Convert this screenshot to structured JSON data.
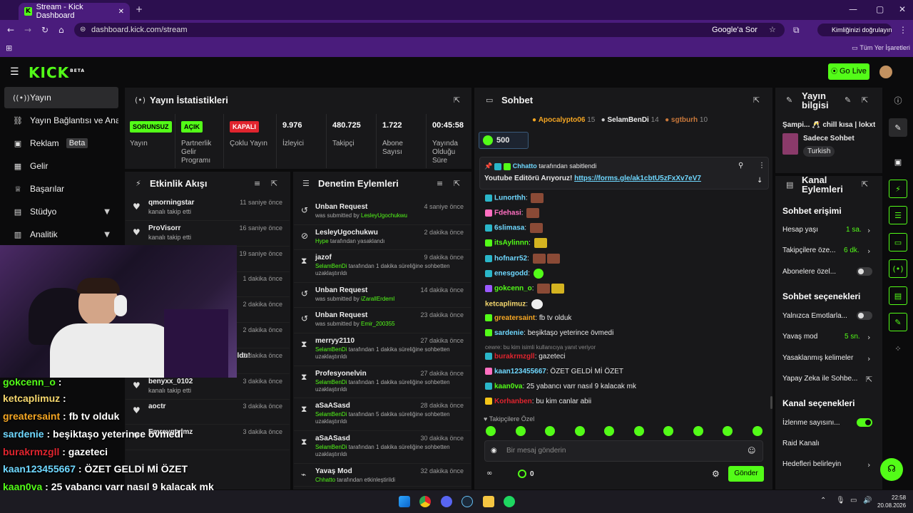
{
  "browser": {
    "tab_title": "Stream - Kick Dashboard",
    "url": "dashboard.kick.com/stream",
    "search_label": "Google'a Sor",
    "profile_label": "Kimliğinizi doğrulayın",
    "bookmarks_label": "Tüm Yer İşaretleri"
  },
  "header": {
    "logo": "KICK",
    "logo_badge": "BETA",
    "go_live": "Go Live"
  },
  "sidebar": {
    "items": [
      {
        "label": "Yayın",
        "icon": "broadcast-icon"
      },
      {
        "label": "Yayın Bağlantısı ve Anahtarı",
        "icon": "link-icon"
      },
      {
        "label": "Reklam",
        "icon": "ad-icon",
        "badge": "Beta"
      },
      {
        "label": "Gelir",
        "icon": "revenue-icon"
      },
      {
        "label": "Başarılar",
        "icon": "trophy-icon"
      },
      {
        "label": "Stüdyo",
        "icon": "studio-icon"
      },
      {
        "label": "Analitik",
        "icon": "analytics-icon"
      }
    ]
  },
  "stats": {
    "title": "Yayın İstatistikleri",
    "cells": [
      {
        "badge": "SORUNSUZ",
        "label": "Yayın",
        "color": "#53fc18"
      },
      {
        "badge": "AÇIK",
        "label": "Partnerlik Gelir Programı",
        "color": "#53fc18"
      },
      {
        "badge": "KAPALI",
        "label": "Çoklu Yayın",
        "color": "#e0242e"
      },
      {
        "value": "9.976",
        "label": "İzleyici"
      },
      {
        "value": "480.725",
        "label": "Takipçi"
      },
      {
        "value": "1.722",
        "label": "Abone Sayısı"
      },
      {
        "value": "00:45:58",
        "label": "Yayında Olduğu Süre"
      }
    ]
  },
  "activity": {
    "title": "Etkinlik Akışı",
    "rows": [
      {
        "name": "qmorningstar",
        "sub": "kanalı takip etti",
        "time": "11 saniye önce"
      },
      {
        "name": "ProVisorr",
        "sub": "kanalı takip etti",
        "time": "16 saniye önce"
      },
      {
        "name": "",
        "sub": "",
        "time": "19 saniye önce"
      },
      {
        "name": "u!",
        "sub": "",
        "time": "1 dakika önce"
      },
      {
        "name": "",
        "sub": "oplam abonelik",
        "time": "2 dakika önce"
      },
      {
        "name": "",
        "sub": "",
        "time": "2 dakika önce"
      },
      {
        "name": "scathaaa yeniden abone oldu!",
        "sub": "12 aylık abone oldular",
        "time": "2 dakika önce"
      },
      {
        "name": "benyxx_0102",
        "sub": "kanalı takip etti",
        "time": "3 dakika önce"
      },
      {
        "name": "aoctr",
        "sub": "",
        "time": "3 dakika önce"
      },
      {
        "name": "Emreygtylmz",
        "sub": "",
        "time": "3 dakika önce"
      }
    ]
  },
  "moderation": {
    "title": "Denetim Eylemleri",
    "rows": [
      {
        "icon": "undo-icon",
        "title": "Unban Request",
        "sub": "was submitted by ",
        "who": "LesleyUgochukwu",
        "sub2": "",
        "time": "4 saniye önce"
      },
      {
        "icon": "ban-icon",
        "title": "LesleyUgochukwu",
        "sub": "",
        "who": "Hype",
        "sub2": " tarafından yasaklandı",
        "time": "2 dakika önce"
      },
      {
        "icon": "hourglass-icon",
        "title": "jazof",
        "sub": "",
        "who": "SelamBenDi",
        "sub2": " tarafından 1 dakika süreliğine sohbetten uzaklaştırıldı",
        "time": "9 dakika önce"
      },
      {
        "icon": "undo-icon",
        "title": "Unban Request",
        "sub": "was submitted by ",
        "who": "iZarallErdeml",
        "sub2": "",
        "time": "14 dakika önce"
      },
      {
        "icon": "undo-icon",
        "title": "Unban Request",
        "sub": "was submitted by ",
        "who": "Emir_200355",
        "sub2": "",
        "time": "23 dakika önce"
      },
      {
        "icon": "hourglass-icon",
        "title": "merryy2110",
        "sub": "",
        "who": "SelamBenDi",
        "sub2": " tarafından 1 dakika süreliğine sohbetten uzaklaştırıldı",
        "time": "27 dakika önce"
      },
      {
        "icon": "hourglass-icon",
        "title": "Profesyonelvin",
        "sub": "",
        "who": "SelamBenDi",
        "sub2": " tarafından 1 dakika süreliğine sohbetten uzaklaştırıldı",
        "time": "27 dakika önce"
      },
      {
        "icon": "hourglass-icon",
        "title": "aSaASasd",
        "sub": "",
        "who": "SelamBenDi",
        "sub2": " tarafından 5 dakika süreliğine sohbetten uzaklaştırıldı",
        "time": "28 dakika önce"
      },
      {
        "icon": "hourglass-icon",
        "title": "aSaASasd",
        "sub": "",
        "who": "SelamBenDi",
        "sub2": " tarafından 1 dakika süreliğine sohbetten uzaklaştırıldı",
        "time": "30 dakika önce"
      },
      {
        "icon": "slow-icon",
        "title": "Yavaş Mod",
        "sub": "",
        "who": "Chhatto",
        "sub2": " tarafından etkinleştirildi",
        "time": "32 dakika önce"
      }
    ]
  },
  "chat": {
    "title": "Sohbet",
    "top": [
      {
        "name": "Apocalypto06",
        "count": "15"
      },
      {
        "name": "SelamBenDi",
        "count": "14"
      },
      {
        "name": "sgtburh",
        "count": "10"
      }
    ],
    "gift_count": "500",
    "pinned_by": "Chhatto",
    "pinned_suffix": "tarafından sabitlendi",
    "pinned_text": "Youtube Editörü Arıyoruz! ",
    "pinned_link": "https://forms.gle/ak1cbtU5zFxXv7eV7",
    "messages": [
      {
        "name": "Lunorthh",
        "color": "#6fd8ff",
        "text": ""
      },
      {
        "name": "Fdehasi",
        "color": "#ff6fc1",
        "text": ""
      },
      {
        "name": "6slimasa",
        "color": "#6fd8ff",
        "text": ""
      },
      {
        "name": "itsAylinnn",
        "color": "#53fc18",
        "text": ""
      },
      {
        "name": "hofnarr52",
        "color": "#6fd8ff",
        "text": ""
      },
      {
        "name": "enesgodd",
        "color": "#6fd8ff",
        "text": ""
      },
      {
        "name": "gokcenn_o",
        "color": "#53fc18",
        "text": ""
      },
      {
        "name": "ketcaplimuz",
        "color": "#f5d76e",
        "text": ""
      },
      {
        "name": "greatersaint",
        "color": "#f5a623",
        "text": "fb tv olduk"
      },
      {
        "name": "sardenie",
        "color": "#6fd8ff",
        "text": "beşiktaşo yeterince övmedi"
      },
      {
        "name": "burakrmzgll",
        "color": "#e0242e",
        "text": "gazeteci"
      },
      {
        "name": "kaan123455667",
        "color": "#6fd8ff",
        "text": "ÖZET GELDİ Mİ ÖZET"
      },
      {
        "name": "kaan0va",
        "color": "#53fc18",
        "text": "25 yabancı varr nasıl 9 kalacak mk"
      },
      {
        "name": "Korhanben",
        "color": "#e0242e",
        "text": "bu kim canlar abii"
      }
    ],
    "reply_note": "cewre: bu kim isimli kullanıcıya yanıt veriyor",
    "followers_label": "Takipçilere Özel",
    "input_placeholder": "Bir mesaj gönderin",
    "points": "0",
    "send": "Gönder"
  },
  "stream_info": {
    "title": "Yayın bilgisi",
    "stream_title": "Şampi... 🥂 chill kısa | lokxtr",
    "category": "Sadece Sohbet",
    "language": "Turkish"
  },
  "channel_actions": {
    "title": "Kanal Eylemleri",
    "chat_access": "Sohbet erişimi",
    "account_age": "Hesap yaşı",
    "account_age_val": "1 sa.",
    "followers_only": "Takipçilere öze...",
    "followers_only_val": "6 dk.",
    "subscribers_only": "Abonelere özel...",
    "chat_options": "Sohbet seçenekleri",
    "emote_only": "Yalnızca Emotlarla...",
    "slow_mode": "Yavaş mod",
    "slow_mode_val": "5 sn.",
    "banned_words": "Yasaklanmış kelimeler",
    "ai_mod": "Yapay Zeka ile Sohbe...",
    "channel_options": "Kanal seçenekleri",
    "view_count": "İzlenme sayısını...",
    "raid": "Raid Kanalı",
    "goals": "Hedefleri belirleyin"
  },
  "overlay_chat": [
    {
      "name": "gokcenn_o",
      "color": "#53fc18",
      "text": " : "
    },
    {
      "name": "ketcaplimuz",
      "color": "#f5d76e",
      "text": " : "
    },
    {
      "name": "greatersaint",
      "color": "#f5a623",
      "text": " : fb tv olduk"
    },
    {
      "name": "sardenie",
      "color": "#6fd8ff",
      "text": " : beşiktaşo yeterince övmedi"
    },
    {
      "name": "burakrmzgll",
      "color": "#e0242e",
      "text": " : gazeteci"
    },
    {
      "name": "kaan123455667",
      "color": "#6fd8ff",
      "text": " : ÖZET GELDİ Mİ ÖZET"
    },
    {
      "name": "kaan0va",
      "color": "#53fc18",
      "text": " : 25 yabancı varr nasıl 9 kalacak mk"
    },
    {
      "name": "Korhanben",
      "color": "#e0242e",
      "text": " : bu kim canlar abii"
    }
  ],
  "taskbar": {
    "time": "22:58",
    "date": "20.08.2026"
  }
}
